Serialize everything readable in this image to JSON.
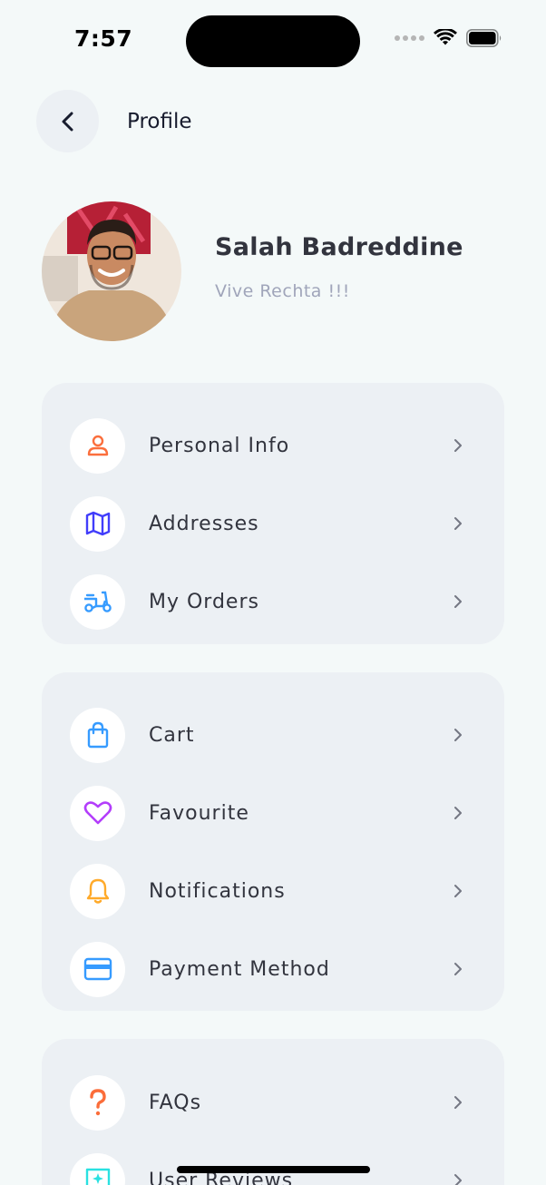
{
  "status_bar": {
    "time": "7:57"
  },
  "header": {
    "title": "Profile"
  },
  "profile": {
    "name": "Salah Badreddine",
    "bio": "Vive Rechta !!!"
  },
  "groups": [
    {
      "items": [
        {
          "label": "Personal Info",
          "icon": "person-icon",
          "color": "#fb6f3d"
        },
        {
          "label": "Addresses",
          "icon": "map-icon",
          "color": "#413dfb"
        },
        {
          "label": "My Orders",
          "icon": "scooter-icon",
          "color": "#369bff"
        }
      ]
    },
    {
      "items": [
        {
          "label": "Cart",
          "icon": "shopping-bag-icon",
          "color": "#369bff"
        },
        {
          "label": "Favourite",
          "icon": "heart-icon",
          "color": "#b33dfb"
        },
        {
          "label": "Notifications",
          "icon": "bell-icon",
          "color": "#ffaa2a"
        },
        {
          "label": "Payment Method",
          "icon": "credit-card-icon",
          "color": "#369bff"
        }
      ]
    },
    {
      "items": [
        {
          "label": "FAQs",
          "icon": "question-icon",
          "color": "#fb6d3a"
        },
        {
          "label": "User Reviews",
          "icon": "review-icon",
          "color": "#2ae1e1"
        }
      ]
    }
  ]
}
